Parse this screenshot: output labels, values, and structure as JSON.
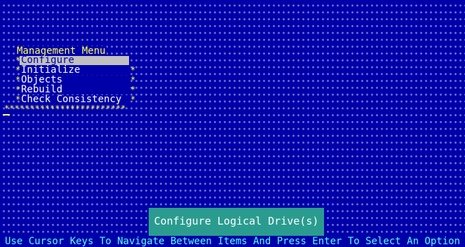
{
  "menu": {
    "title": "Management Menu",
    "items": [
      {
        "label": "Configure",
        "selected": true
      },
      {
        "label": "Initialize",
        "selected": false
      },
      {
        "label": "Objects",
        "selected": false
      },
      {
        "label": "Rebuild",
        "selected": false
      },
      {
        "label": "Check Consistency",
        "selected": false
      }
    ]
  },
  "dialog": {
    "text": "Configure Logical Drive(s)"
  },
  "help": {
    "text": "Use Cursor Keys To Navigate Between Items And Press Enter To Select An Option"
  },
  "colors": {
    "background": "#0000a8",
    "highlight": "#c0c0c0",
    "accent_yellow": "#ffff54",
    "dialog": "#2a9c8f",
    "help_text": "#55ffff"
  }
}
